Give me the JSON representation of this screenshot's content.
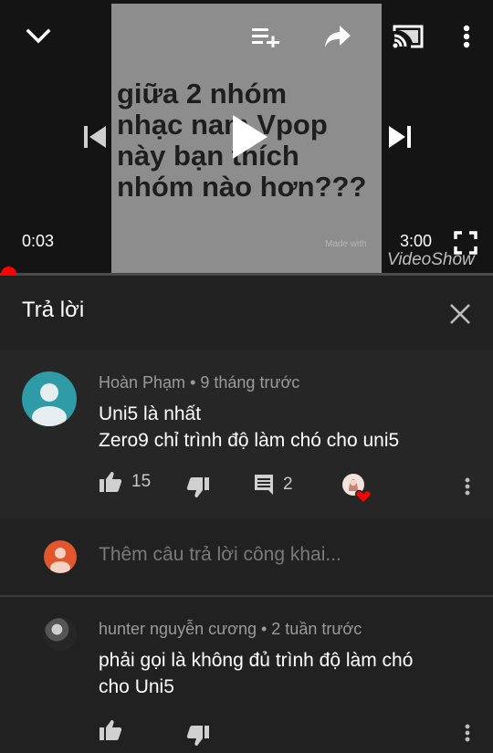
{
  "video": {
    "overlay_lines": [
      "giữa 2 nhóm",
      "nhạc nam Vpop",
      "này bạn thích",
      "nhóm nào hơn???"
    ],
    "watermark_small": "Made with",
    "watermark": "VideoShow",
    "current_time": "0:03",
    "duration": "3:00",
    "progress_fraction": 0.017
  },
  "panel": {
    "title": "Trả lời"
  },
  "parent_comment": {
    "author": "Hoàn Phạm",
    "age": "9 tháng trước",
    "lines": [
      "Uni5 là nhất",
      "Zero9 chỉ trình độ làm chó cho uni5"
    ],
    "likes": "15",
    "replies": "2"
  },
  "reply_box": {
    "placeholder": "Thêm câu trả lời công khai..."
  },
  "replies": [
    {
      "author": "hunter nguyễn cương",
      "age": "2 tuần trước",
      "lines": [
        "phải gọi là không đủ trình độ làm chó",
        "cho Uni5"
      ]
    }
  ],
  "colors": {
    "accent": "#ff0000",
    "background": "#212121",
    "comment_bg": "#262626",
    "secondary_text": "#9b9b9b"
  },
  "icons": {
    "collapse": "chevron-down-icon",
    "add_to_playlist": "playlist-add-icon",
    "share": "share-icon",
    "cast": "cast-icon",
    "more": "more-vert-icon",
    "previous": "skip-previous-icon",
    "play": "play-icon",
    "next": "skip-next-icon",
    "fullscreen": "fullscreen-icon",
    "close": "close-icon",
    "like": "thumb-up-icon",
    "dislike": "thumb-down-icon",
    "reply": "comment-icon",
    "creator_heart": "creator-heart-icon"
  }
}
